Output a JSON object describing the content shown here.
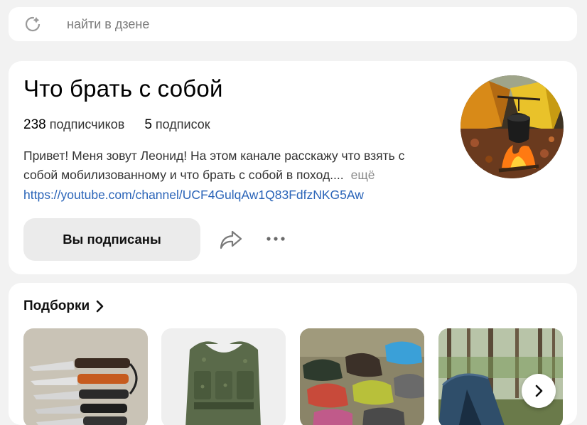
{
  "search": {
    "placeholder": "найти в дзене"
  },
  "channel": {
    "title": "Что брать с собой",
    "subscribers_count": "238",
    "subscribers_label": "подписчиков",
    "subscriptions_count": "5",
    "subscriptions_label": "подписок",
    "description": "Привет! Меня зовут Леонид! На этом канале расскажу что взять с собой мобилизованному и что брать с собой в поход....",
    "more_label": "ещё",
    "link": "https://youtube.com/channel/UCF4GulqAw1Q83FdfzNKG5Aw",
    "subscribed_label": "Вы подписаны",
    "avatar_icon": "camp-cauldron-avatar",
    "share_icon": "share-arrow-icon",
    "more_icon": "more-dots-icon"
  },
  "selections": {
    "title": "Подборки",
    "items": [
      {
        "icon": "knives-thumbnail"
      },
      {
        "icon": "tactical-vest-thumbnail"
      },
      {
        "icon": "shoes-thumbnail"
      },
      {
        "icon": "tent-forest-thumbnail"
      }
    ],
    "next_icon": "chevron-right-icon"
  }
}
